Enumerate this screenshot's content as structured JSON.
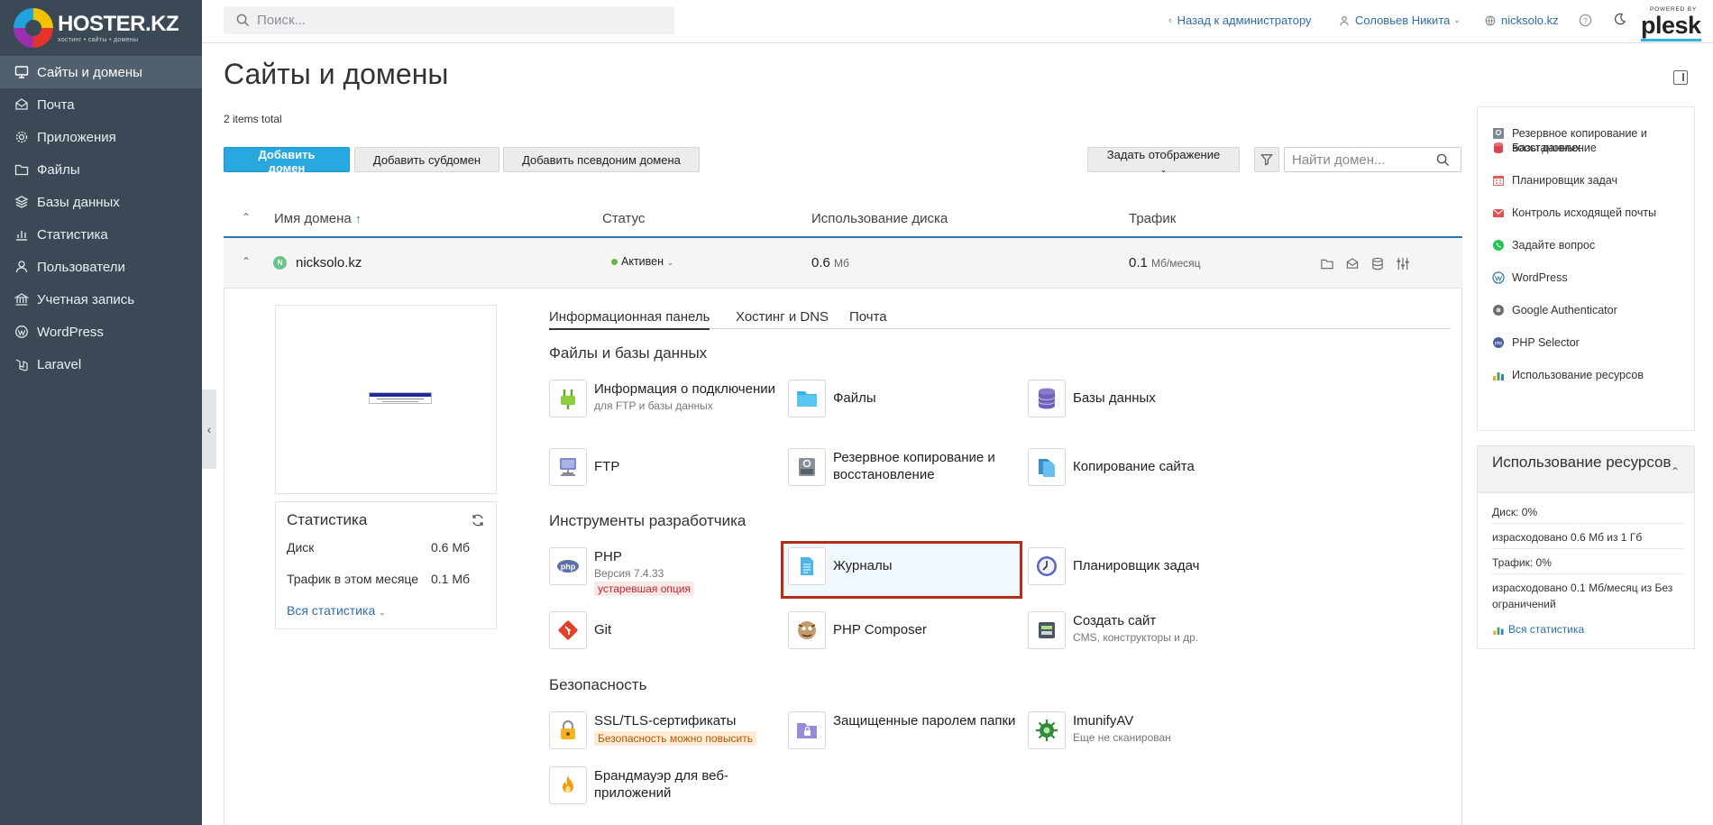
{
  "logo": {
    "name": "HOSTER.KZ",
    "tagline": "хостинг • сайты • домены"
  },
  "sidebar": {
    "items": [
      {
        "label": "Сайты и домены",
        "icon": "monitor-icon",
        "active": true
      },
      {
        "label": "Почта",
        "icon": "mail-icon"
      },
      {
        "label": "Приложения",
        "icon": "gear-icon"
      },
      {
        "label": "Файлы",
        "icon": "folder-icon"
      },
      {
        "label": "Базы данных",
        "icon": "layers-icon"
      },
      {
        "label": "Статистика",
        "icon": "bar-chart-icon"
      },
      {
        "label": "Пользователи",
        "icon": "user-icon"
      },
      {
        "label": "Учетная запись",
        "icon": "bank-icon"
      },
      {
        "label": "WordPress",
        "icon": "wordpress-icon"
      },
      {
        "label": "Laravel",
        "icon": "laravel-icon"
      }
    ]
  },
  "topbar": {
    "search_placeholder": "Поиск...",
    "back_to_admin": "Назад к администратору",
    "user_name": "Соловьев Никита",
    "domain": "nicksolo.kz",
    "powered_by": "POWERED BY",
    "brand": "plesk"
  },
  "page": {
    "title": "Сайты и домены",
    "items_total": "2 items total"
  },
  "toolbar": {
    "add_domain": "Добавить домен",
    "add_subdomain": "Добавить субдомен",
    "add_alias": "Добавить псевдоним домена",
    "set_view": "Задать отображение",
    "domain_search_placeholder": "Найти домен..."
  },
  "table": {
    "columns": [
      "Имя домена",
      "Статус",
      "Использование диска",
      "Трафик"
    ],
    "row": {
      "domain": "nicksolo.kz",
      "status": "Активен",
      "disk_value": "0.6",
      "disk_unit": "Мб",
      "traffic_value": "0.1",
      "traffic_unit": "Мб/месяц"
    }
  },
  "stats": {
    "title": "Статистика",
    "disk_label": "Диск",
    "disk_value": "0.6 Мб",
    "traffic_label": "Трафик в этом месяце",
    "traffic_value": "0.1 Мб",
    "all_stats": "Вся статистика"
  },
  "tabs": [
    "Информационная панель",
    "Хостинг и DNS",
    "Почта"
  ],
  "sections": {
    "files": {
      "title": "Файлы и базы данных",
      "tiles": [
        {
          "title": "Информация о подключении",
          "sub": "для FTP и базы данных"
        },
        {
          "title": "Файлы"
        },
        {
          "title": "Базы данных"
        },
        {
          "title": "FTP"
        },
        {
          "title": "Резервное копирование и восстановление"
        },
        {
          "title": "Копирование сайта"
        }
      ]
    },
    "dev": {
      "title": "Инструменты разработчика",
      "tiles": [
        {
          "title": "PHP",
          "sub": "Версия 7.4.33",
          "badge": "устаревшая опция"
        },
        {
          "title": "Журналы"
        },
        {
          "title": "Планировщик задач"
        },
        {
          "title": "Git"
        },
        {
          "title": "PHP Composer"
        },
        {
          "title": "Создать сайт",
          "sub": "CMS, конструкторы и др."
        }
      ]
    },
    "security": {
      "title": "Безопасность",
      "tiles": [
        {
          "title": "SSL/TLS-сертификаты",
          "badge": "Безопасность можно повысить"
        },
        {
          "title": "Защищенные паролем папки"
        },
        {
          "title": "ImunifyAV",
          "sub": "Еще не сканирован"
        },
        {
          "title": "Брандмауэр для веб-приложений"
        }
      ]
    }
  },
  "right_panel": {
    "links": [
      "Резервное копирование и восстановление",
      "Базы данных",
      "Планировщик задач",
      "Контроль исходящей почты",
      "Задайте вопрос",
      "WordPress",
      "Google Authenticator",
      "PHP Selector",
      "Использование ресурсов"
    ],
    "usage": {
      "title": "Использование ресурсов",
      "disk_label": "Диск:",
      "disk_percent": "0%",
      "disk_used": "израсходовано 0.6 Мб из 1 Гб",
      "traffic_label": "Трафик:",
      "traffic_percent": "0%",
      "traffic_used": "израсходовано 0.1 Мб/месяц из Без ограничений",
      "all_stats": "Вся статистика"
    }
  },
  "colors": {
    "sidebar": "#3b4956",
    "accent": "#28a8de",
    "link": "#2d6ea8",
    "active_status": "#6cb33e",
    "highlight": "#b32d15"
  }
}
